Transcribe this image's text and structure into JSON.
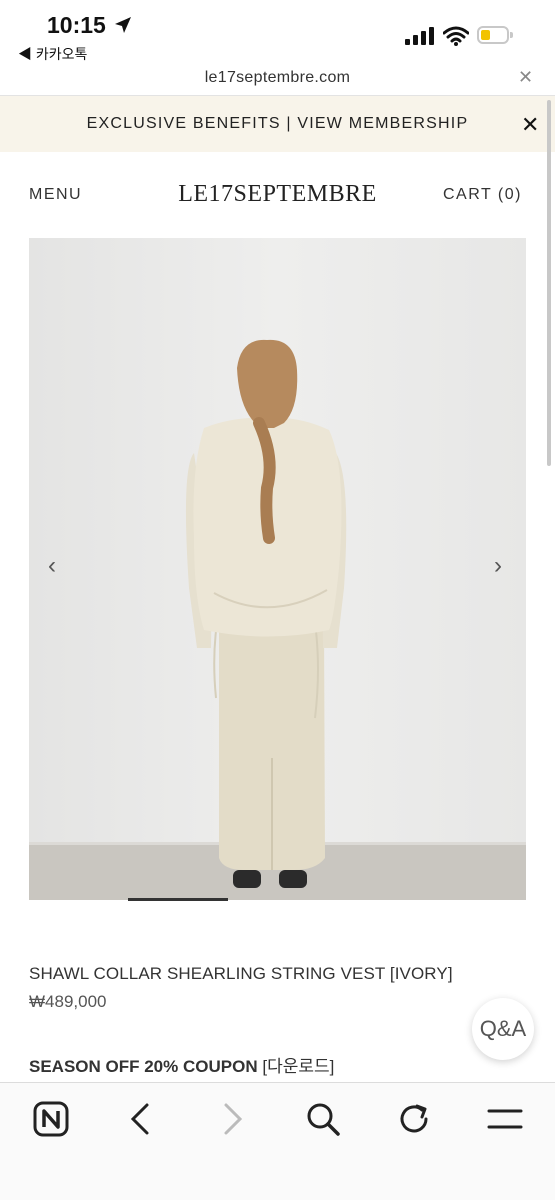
{
  "status_bar": {
    "time": "10:15",
    "back_app": "◀ 카카오톡",
    "battery_color": "#f2c300"
  },
  "browser": {
    "url": "le17septembre.com",
    "close_icon": "close-icon"
  },
  "promo_banner": {
    "text": "EXCLUSIVE BENEFITS | VIEW MEMBERSHIP"
  },
  "header": {
    "menu_label": "MENU",
    "logo": "LE17SEPTEMBRE",
    "cart_label": "CART (0)"
  },
  "product": {
    "name": "SHAWL COLLAR SHEARLING STRING VEST [IVORY]",
    "price": "₩489,000",
    "coupon_bold": "SEASON OFF 20% COUPON",
    "coupon_link": "[다운로드]",
    "gallery": {
      "prev_icon": "chevron-left-icon",
      "next_icon": "chevron-right-icon",
      "current_slide_fraction": 0.2
    }
  },
  "qa_button": {
    "label": "Q&A"
  },
  "toolbar": {
    "items": [
      "naver-icon",
      "back-icon",
      "forward-icon",
      "search-icon",
      "reload-icon",
      "menu-icon"
    ]
  }
}
